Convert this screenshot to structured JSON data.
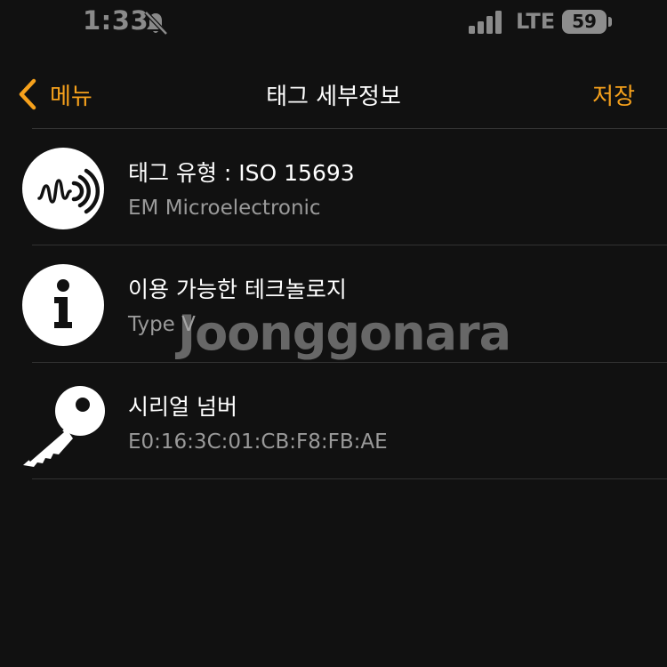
{
  "status_bar": {
    "time": "1:33",
    "network": "LTE",
    "battery": "59",
    "icons": [
      "bell-slash-icon",
      "signal-icon",
      "battery-icon"
    ]
  },
  "nav": {
    "back_label": "메뉴",
    "title": "태그 세부정보",
    "save_label": "저장"
  },
  "items": [
    {
      "icon": "nfc-wave-icon",
      "title": "태그 유형 : ISO 15693",
      "subtitle": "EM Microelectronic"
    },
    {
      "icon": "info-icon",
      "title": "이용 가능한 테크놀로지",
      "subtitle": "Type V"
    },
    {
      "icon": "key-icon",
      "title": "시리얼 넘버",
      "subtitle": "E0:16:3C:01:CB:F8:FB:AE"
    }
  ],
  "watermark": "Joonggonara",
  "colors": {
    "background": "#111111",
    "accent": "#f6a11c",
    "primary_text": "#ffffff",
    "secondary_text": "#9a9a9a",
    "status_text": "#8a8a8a"
  }
}
